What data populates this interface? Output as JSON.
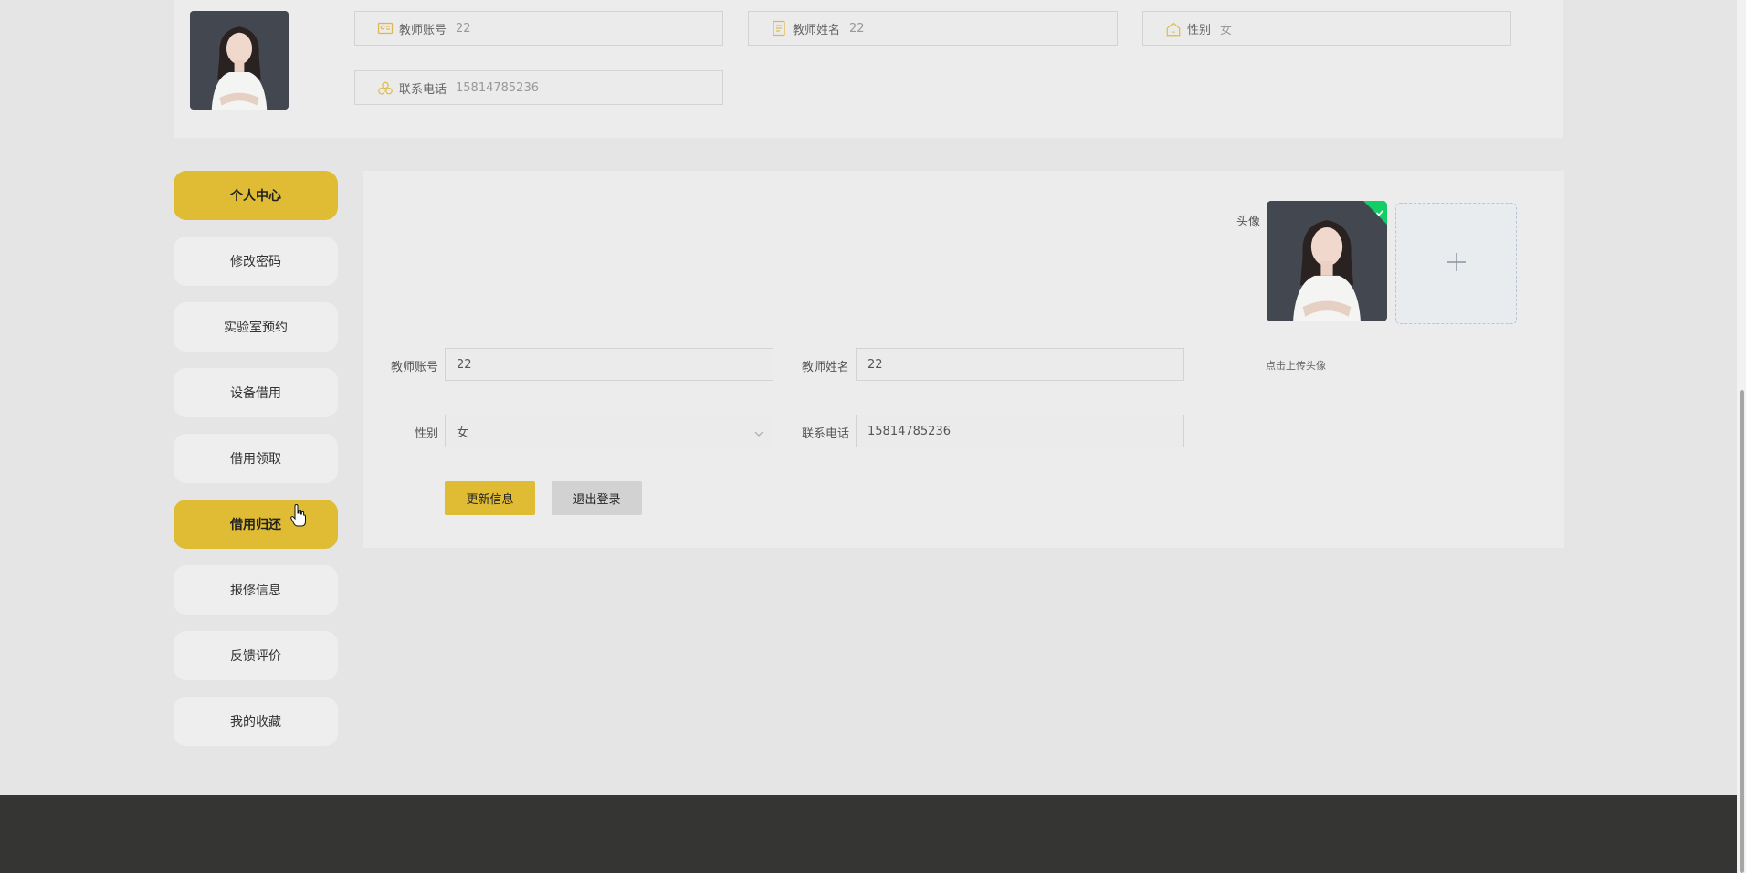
{
  "profile_header": {
    "fields": [
      {
        "icon": "id-card-icon",
        "label": "教师账号",
        "value": "22"
      },
      {
        "icon": "document-icon",
        "label": "教师姓名",
        "value": "22"
      },
      {
        "icon": "home-icon",
        "label": "性别",
        "value": "女"
      },
      {
        "icon": "contacts-icon",
        "label": "联系电话",
        "value": "15814785236"
      }
    ]
  },
  "sidebar": {
    "items": [
      {
        "label": "个人中心",
        "active": true
      },
      {
        "label": "修改密码",
        "active": false
      },
      {
        "label": "实验室预约",
        "active": false
      },
      {
        "label": "设备借用",
        "active": false
      },
      {
        "label": "借用领取",
        "active": false
      },
      {
        "label": "借用归还",
        "active": true
      },
      {
        "label": "报修信息",
        "active": false
      },
      {
        "label": "反馈评价",
        "active": false
      },
      {
        "label": "我的收藏",
        "active": false
      }
    ]
  },
  "form": {
    "avatar_label": "头像",
    "upload_hint": "点击上传头像",
    "account_label": "教师账号",
    "account_value": "22",
    "name_label": "教师姓名",
    "name_value": "22",
    "gender_label": "性别",
    "gender_value": "女",
    "phone_label": "联系电话",
    "phone_value": "15814785236",
    "update_button": "更新信息",
    "logout_button": "退出登录"
  },
  "colors": {
    "accent": "#dfbc33",
    "footer": "#353533",
    "success_badge": "#13ce66"
  }
}
